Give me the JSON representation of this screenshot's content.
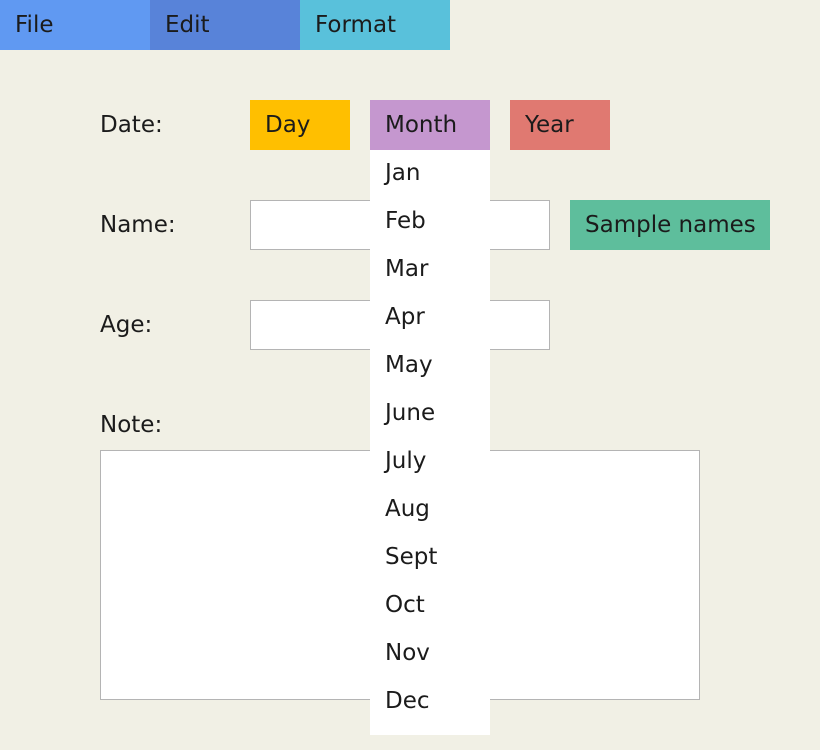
{
  "menubar": {
    "items": [
      "File",
      "Edit",
      "Format"
    ]
  },
  "form": {
    "date_label": "Date:",
    "day_label": "Day",
    "month_label": "Month",
    "year_label": "Year",
    "name_label": "Name:",
    "name_value": "",
    "sample_names_label": "Sample names",
    "age_label": "Age:",
    "age_value": "",
    "note_label": "Note:",
    "note_value": ""
  },
  "month_dropdown": {
    "options": [
      "Jan",
      "Feb",
      "Mar",
      "Apr",
      "May",
      "June",
      "July",
      "Aug",
      "Sept",
      "Oct",
      "Nov",
      "Dec"
    ]
  },
  "colors": {
    "background": "#f1f0e5",
    "file_menu": "#6099f2",
    "edit_menu": "#5883d9",
    "format_menu": "#59c1db",
    "day_button": "#ffbf00",
    "month_button": "#c597cf",
    "year_button": "#e07971",
    "sample_names_button": "#5ebe9c"
  }
}
